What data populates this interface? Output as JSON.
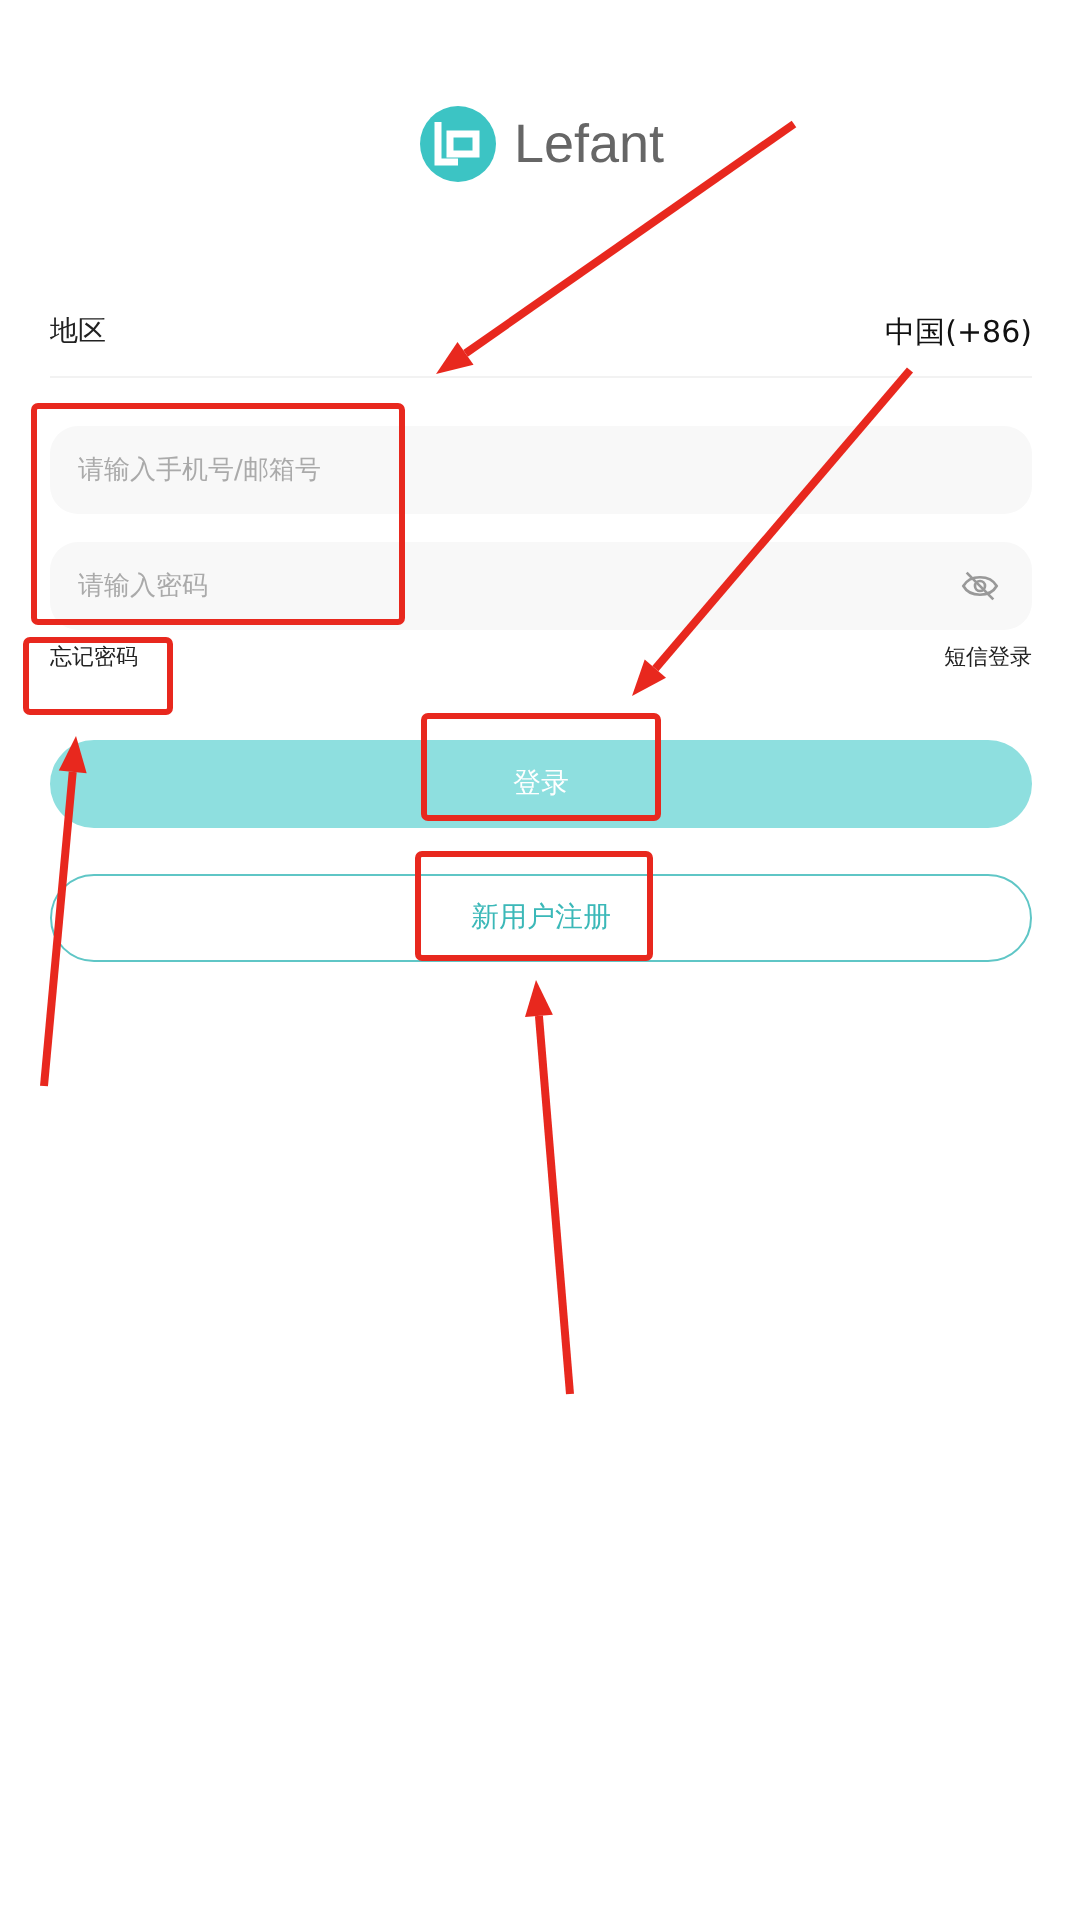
{
  "logo": {
    "text": "Lefant"
  },
  "region": {
    "label": "地区",
    "value": "中国(+86)"
  },
  "account_field": {
    "placeholder": "请输入手机号/邮箱号"
  },
  "password_field": {
    "placeholder": "请输入密码",
    "visible": false
  },
  "links": {
    "forgot": "忘记密码",
    "sms": "短信登录"
  },
  "login_button": {
    "label": "登录",
    "disabled": true
  },
  "register_button": {
    "label": "新用户注册"
  }
}
